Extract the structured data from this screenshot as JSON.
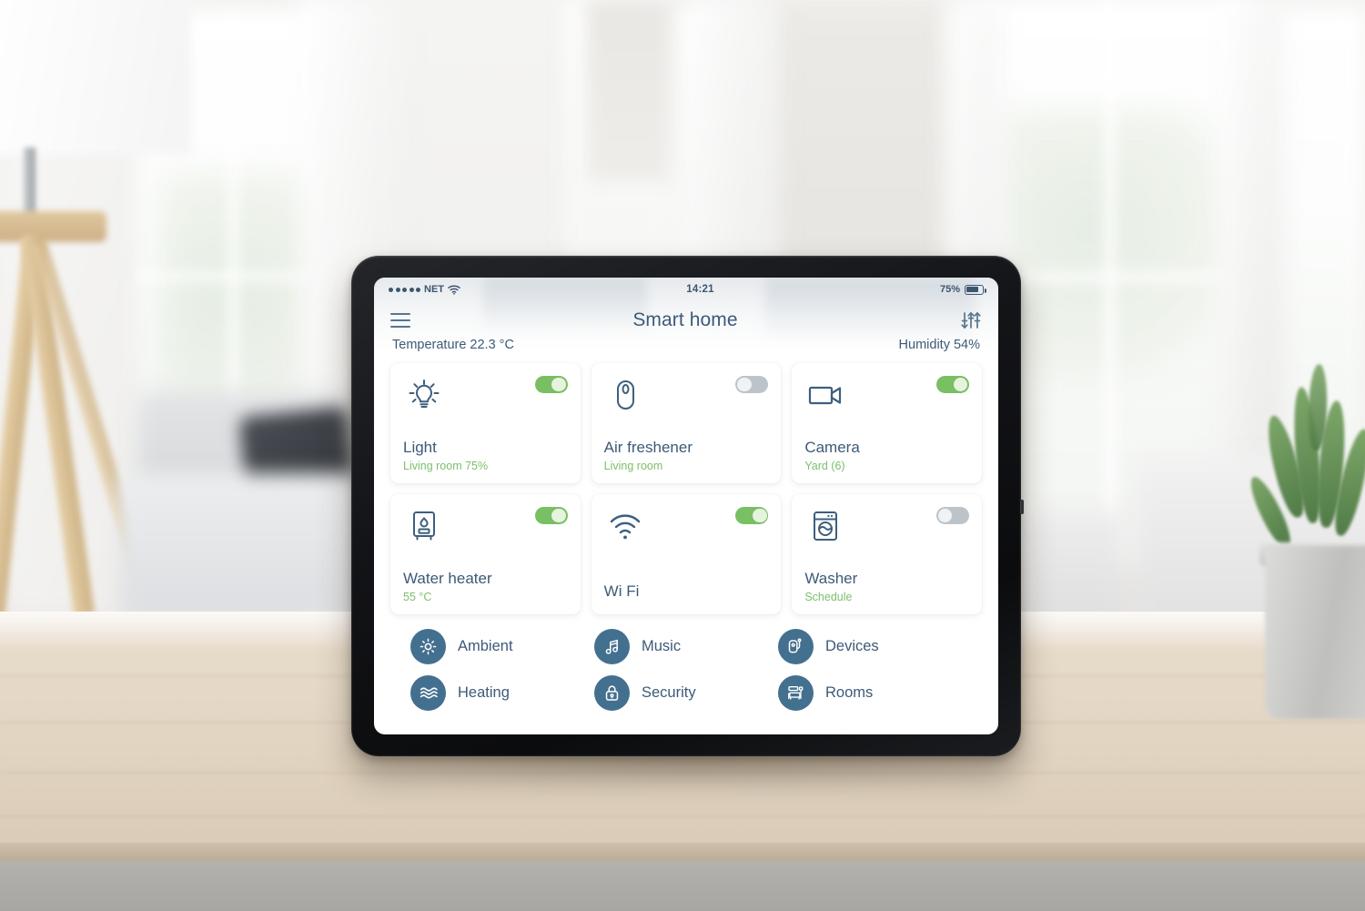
{
  "status_bar": {
    "carrier": "NET",
    "signal_dots": 5,
    "wifi_icon": "wifi-icon",
    "time": "14:21",
    "battery_percent": "75%",
    "battery_level": 75
  },
  "app_bar": {
    "menu_icon": "hamburger-icon",
    "title": "Smart home",
    "settings_icon": "equalizer-icon"
  },
  "environment": {
    "temperature": "Temperature 22.3 °C",
    "humidity": "Humidity 54%"
  },
  "colors": {
    "accent_blue": "#3c5a78",
    "icon_blue": "#3e5f7e",
    "circle_blue": "#44708f",
    "toggle_on": "#79bf63",
    "toggle_off": "#bcc4ca",
    "subtitle_green": "#7dbf6b",
    "card_bg": "#ffffff",
    "screen_bg": "#ffffff",
    "bezel": "#121315"
  },
  "devices": [
    {
      "icon": "lightbulb-icon",
      "title": "Light",
      "subtitle": "Living room 75%",
      "toggle": "on"
    },
    {
      "icon": "air-freshener-icon",
      "title": "Air freshener",
      "subtitle": "Living room",
      "toggle": "off"
    },
    {
      "icon": "camera-icon",
      "title": "Camera",
      "subtitle": "Yard (6)",
      "toggle": "on"
    },
    {
      "icon": "water-heater-icon",
      "title": "Water heater",
      "subtitle": "55 °C",
      "toggle": "on"
    },
    {
      "icon": "wifi-icon",
      "title": "Wi Fi",
      "subtitle": "",
      "toggle": "on"
    },
    {
      "icon": "washer-icon",
      "title": "Washer",
      "subtitle": "Schedule",
      "toggle": "off"
    }
  ],
  "menu": [
    {
      "icon": "sun-icon",
      "label": "Ambient"
    },
    {
      "icon": "music-icon",
      "label": "Music"
    },
    {
      "icon": "plug-icon",
      "label": "Devices"
    },
    {
      "icon": "waves-icon",
      "label": "Heating"
    },
    {
      "icon": "lock-icon",
      "label": "Security"
    },
    {
      "icon": "rooms-icon",
      "label": "Rooms"
    }
  ]
}
